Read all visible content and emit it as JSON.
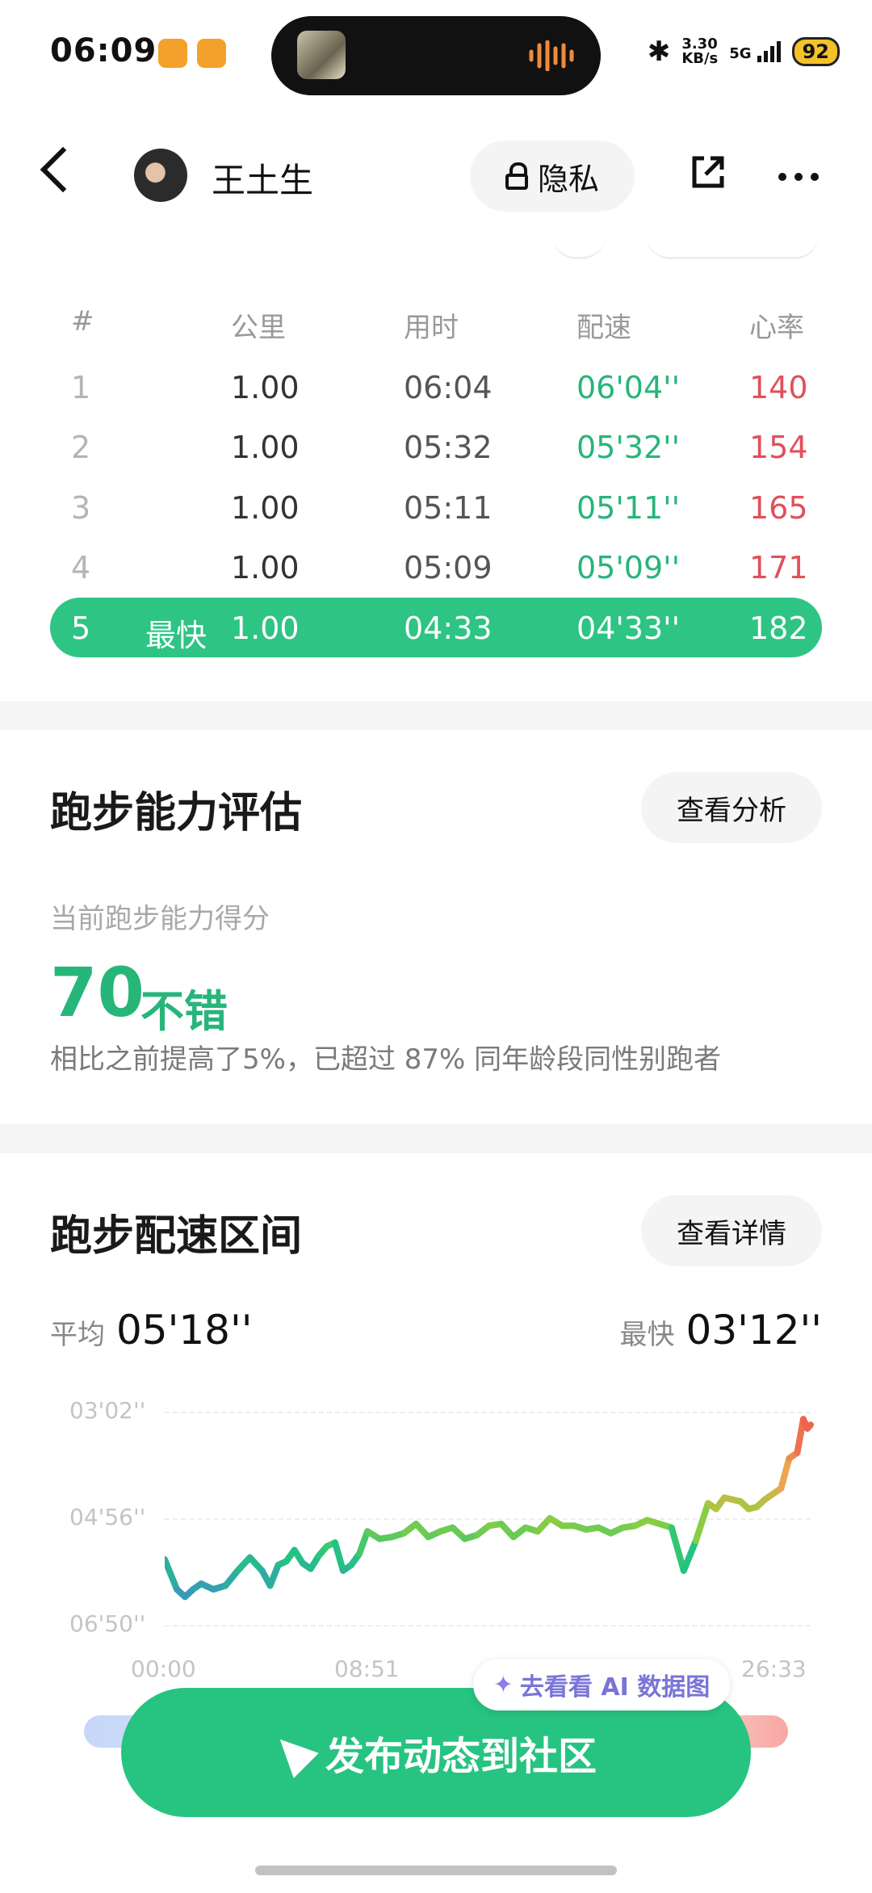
{
  "status_bar": {
    "time": "06:09",
    "net_speed_top": "3.30",
    "net_speed_bottom": "KB/s",
    "signal": "5G",
    "battery": "92"
  },
  "header": {
    "username": "王土生",
    "privacy_label": "隐私"
  },
  "splits": {
    "headers": [
      "#",
      "公里",
      "用时",
      "配速",
      "心率"
    ],
    "rows": [
      {
        "idx": "1",
        "tag": "",
        "km": "1.00",
        "time": "06:04",
        "pace": "06'04''",
        "hr": "140"
      },
      {
        "idx": "2",
        "tag": "",
        "km": "1.00",
        "time": "05:32",
        "pace": "05'32''",
        "hr": "154"
      },
      {
        "idx": "3",
        "tag": "",
        "km": "1.00",
        "time": "05:11",
        "pace": "05'11''",
        "hr": "165"
      },
      {
        "idx": "4",
        "tag": "",
        "km": "1.00",
        "time": "05:09",
        "pace": "05'09''",
        "hr": "171"
      },
      {
        "idx": "5",
        "tag": "最快",
        "km": "1.00",
        "time": "04:33",
        "pace": "04'33''",
        "hr": "182"
      }
    ]
  },
  "ability": {
    "title": "跑步能力评估",
    "button": "查看分析",
    "subtitle": "当前跑步能力得分",
    "score": "70",
    "score_word": "不错",
    "desc": "相比之前提高了5%，已超过 87% 同年龄段同性别跑者"
  },
  "pace_zone": {
    "title": "跑步配速区间",
    "button": "查看详情",
    "avg_label": "平均",
    "avg_value": "05'18''",
    "fast_label": "最快",
    "fast_value": "03'12''"
  },
  "ai_chip": {
    "label": "去看看 AI 数据图"
  },
  "cta": {
    "label": "发布动态到社区"
  },
  "colors": {
    "accent": "#27c381",
    "pace_green": "#27b57a",
    "hr_red": "#e0505a"
  },
  "chart_data": {
    "type": "line",
    "title": "",
    "xlabel": "",
    "ylabel": "",
    "y_ticks": [
      "03'02''",
      "04'56''",
      "06'50''"
    ],
    "x_ticks": [
      "00:00",
      "08:51",
      "26:33"
    ],
    "ylim_seconds_per_km": [
      182,
      410
    ],
    "y_inverted": true,
    "xlim_seconds": [
      0,
      1593
    ],
    "series": [
      {
        "x": [
          0,
          30,
          50,
          70,
          90,
          120,
          150,
          180,
          210,
          240,
          260,
          280,
          300,
          320,
          340,
          360,
          380,
          400,
          420,
          440,
          460,
          480,
          500,
          530,
          560,
          590,
          620,
          650,
          680,
          710,
          740,
          770,
          800,
          830,
          860,
          890,
          920,
          950,
          980,
          1010,
          1040,
          1070,
          1100,
          1130,
          1160,
          1190,
          1220,
          1250,
          1280,
          1310,
          1340,
          1360,
          1380,
          1400,
          1420,
          1440,
          1460,
          1480,
          1500,
          1520,
          1540,
          1560,
          1575,
          1585,
          1593
        ],
        "pace_seconds": [
          340,
          372,
          380,
          372,
          366,
          372,
          368,
          352,
          338,
          352,
          368,
          346,
          342,
          330,
          344,
          350,
          336,
          326,
          322,
          352,
          346,
          334,
          310,
          318,
          316,
          312,
          302,
          316,
          310,
          306,
          318,
          314,
          304,
          302,
          316,
          306,
          310,
          296,
          304,
          304,
          308,
          306,
          312,
          306,
          304,
          298,
          302,
          306,
          352,
          320,
          280,
          286,
          274,
          276,
          278,
          286,
          284,
          276,
          270,
          264,
          232,
          226,
          190,
          200,
          196
        ]
      }
    ]
  }
}
